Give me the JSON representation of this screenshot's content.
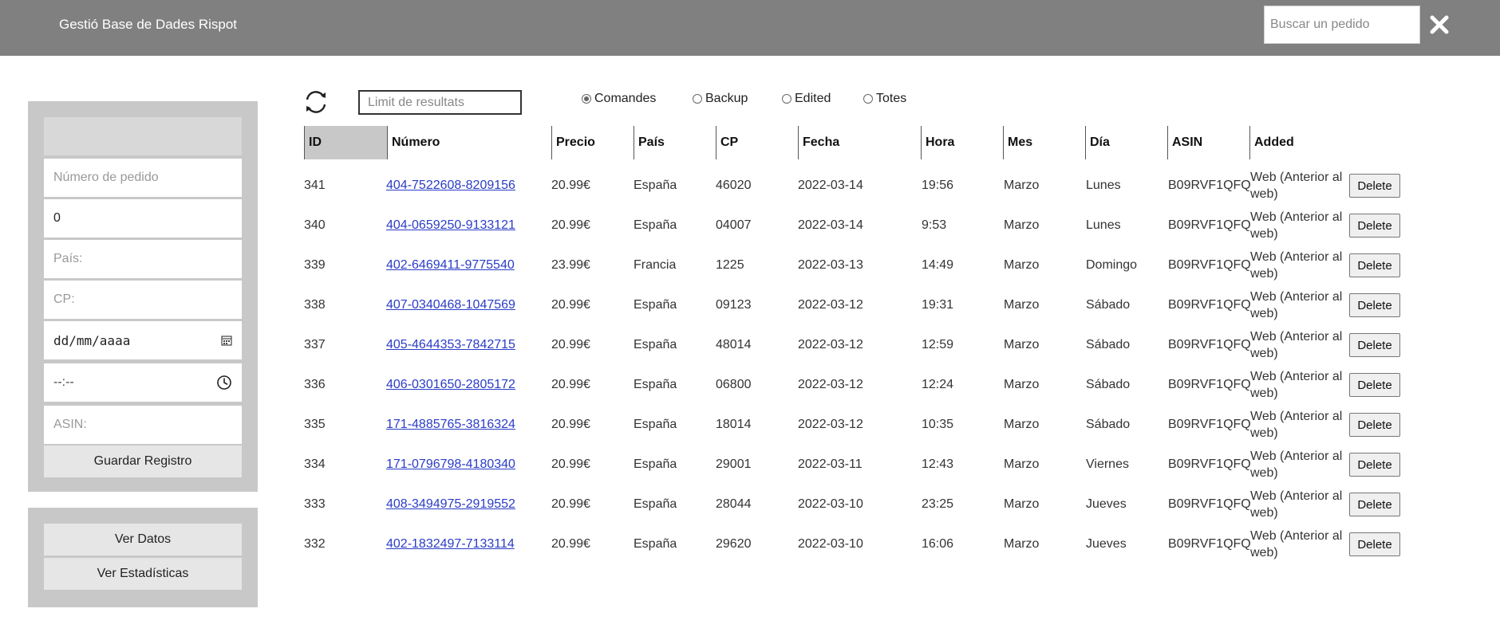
{
  "header": {
    "title": "Gestió Base de Dades Rispot",
    "search_placeholder": "Buscar un pedido"
  },
  "form": {
    "numero_placeholder": "Número de pedido",
    "price_value": "0",
    "pais_placeholder": "País:",
    "cp_placeholder": "CP:",
    "date_value": "dd/mm/aaaa",
    "time_value": "--:--",
    "asin_placeholder": "ASIN:",
    "save_label": "Guardar Registro"
  },
  "nav": {
    "ver_datos": "Ver Datos",
    "ver_estadisticas": "Ver Estadísticas"
  },
  "toolbar": {
    "limit_placeholder": "Limit de resultats",
    "radios": [
      {
        "label": "Comandes",
        "checked": true
      },
      {
        "label": "Backup",
        "checked": false
      },
      {
        "label": "Edited",
        "checked": false
      },
      {
        "label": "Totes",
        "checked": false
      }
    ]
  },
  "table": {
    "headers": [
      "ID",
      "Número",
      "Precio",
      "País",
      "CP",
      "Fecha",
      "Hora",
      "Mes",
      "Día",
      "ASIN",
      "Added"
    ],
    "delete_label": "Delete",
    "rows": [
      [
        "341",
        "404-7522608-8209156",
        "20.99€",
        "España",
        "46020",
        "2022-03-14",
        "19:56",
        "Marzo",
        "Lunes",
        "B09RVF1QFQ",
        "Web (Anterior al web)"
      ],
      [
        "340",
        "404-0659250-9133121",
        "20.99€",
        "España",
        "04007",
        "2022-03-14",
        "9:53",
        "Marzo",
        "Lunes",
        "B09RVF1QFQ",
        "Web (Anterior al web)"
      ],
      [
        "339",
        "402-6469411-9775540",
        "23.99€",
        "Francia",
        "1225",
        "2022-03-13",
        "14:49",
        "Marzo",
        "Domingo",
        "B09RVF1QFQ",
        "Web (Anterior al web)"
      ],
      [
        "338",
        "407-0340468-1047569",
        "20.99€",
        "España",
        "09123",
        "2022-03-12",
        "19:31",
        "Marzo",
        "Sábado",
        "B09RVF1QFQ",
        "Web (Anterior al web)"
      ],
      [
        "337",
        "405-4644353-7842715",
        "20.99€",
        "España",
        "48014",
        "2022-03-12",
        "12:59",
        "Marzo",
        "Sábado",
        "B09RVF1QFQ",
        "Web (Anterior al web)"
      ],
      [
        "336",
        "406-0301650-2805172",
        "20.99€",
        "España",
        "06800",
        "2022-03-12",
        "12:24",
        "Marzo",
        "Sábado",
        "B09RVF1QFQ",
        "Web (Anterior al web)"
      ],
      [
        "335",
        "171-4885765-3816324",
        "20.99€",
        "España",
        "18014",
        "2022-03-12",
        "10:35",
        "Marzo",
        "Sábado",
        "B09RVF1QFQ",
        "Web (Anterior al web)"
      ],
      [
        "334",
        "171-0796798-4180340",
        "20.99€",
        "España",
        "29001",
        "2022-03-11",
        "12:43",
        "Marzo",
        "Viernes",
        "B09RVF1QFQ",
        "Web (Anterior al web)"
      ],
      [
        "333",
        "408-3494975-2919552",
        "20.99€",
        "España",
        "28044",
        "2022-03-10",
        "23:25",
        "Marzo",
        "Jueves",
        "B09RVF1QFQ",
        "Web (Anterior al web)"
      ],
      [
        "332",
        "402-1832497-7133114",
        "20.99€",
        "España",
        "29620",
        "2022-03-10",
        "16:06",
        "Marzo",
        "Jueves",
        "B09RVF1QFQ",
        "Web (Anterior al web)"
      ]
    ]
  }
}
